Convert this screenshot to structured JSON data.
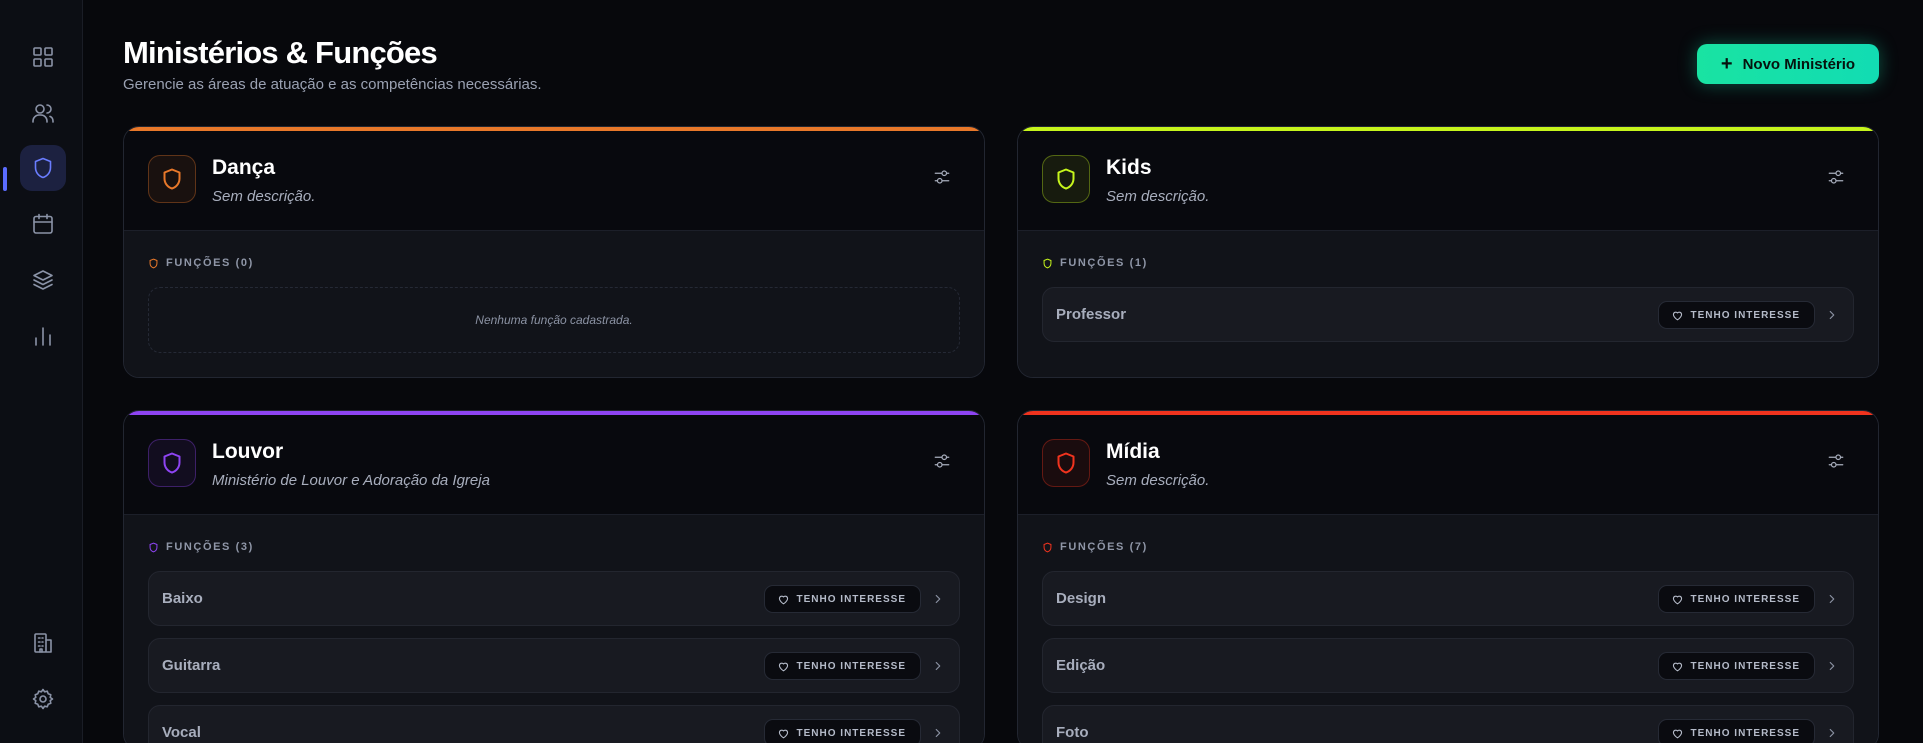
{
  "page": {
    "title": "Ministérios & Funções",
    "subtitle": "Gerencie as áreas de atuação e as competências necessárias.",
    "new_button_label": "Novo Ministério"
  },
  "sidebar": {
    "items": [
      {
        "icon": "dashboard-grid-icon",
        "active": false
      },
      {
        "icon": "users-icon",
        "active": false
      },
      {
        "icon": "shield-icon",
        "active": true
      },
      {
        "icon": "calendar-icon",
        "active": false
      },
      {
        "icon": "layers-icon",
        "active": false
      },
      {
        "icon": "bar-chart-icon",
        "active": false
      },
      {
        "icon": "building-icon",
        "active": false
      },
      {
        "icon": "gear-icon",
        "active": false
      }
    ]
  },
  "interest_label": "TENHO INTERESSE",
  "ministries": [
    {
      "name": "Dança",
      "description": "Sem descrição.",
      "color": "#e8782a",
      "functions_label": "FUNÇÕES (0)",
      "empty_text": "Nenhuma função cadastrada.",
      "functions": []
    },
    {
      "name": "Kids",
      "description": "Sem descrição.",
      "color": "#c6f51c",
      "functions_label": "FUNÇÕES (1)",
      "functions": [
        "Professor"
      ]
    },
    {
      "name": "Louvor",
      "description": "Ministério de Louvor e Adoração da Igreja",
      "color": "#8e44f2",
      "functions_label": "FUNÇÕES (3)",
      "functions": [
        "Baixo",
        "Guitarra",
        "Vocal"
      ]
    },
    {
      "name": "Mídia",
      "description": "Sem descrição.",
      "color": "#f0331e",
      "functions_label": "FUNÇÕES (7)",
      "functions": [
        "Design",
        "Edição",
        "Foto"
      ]
    }
  ]
}
